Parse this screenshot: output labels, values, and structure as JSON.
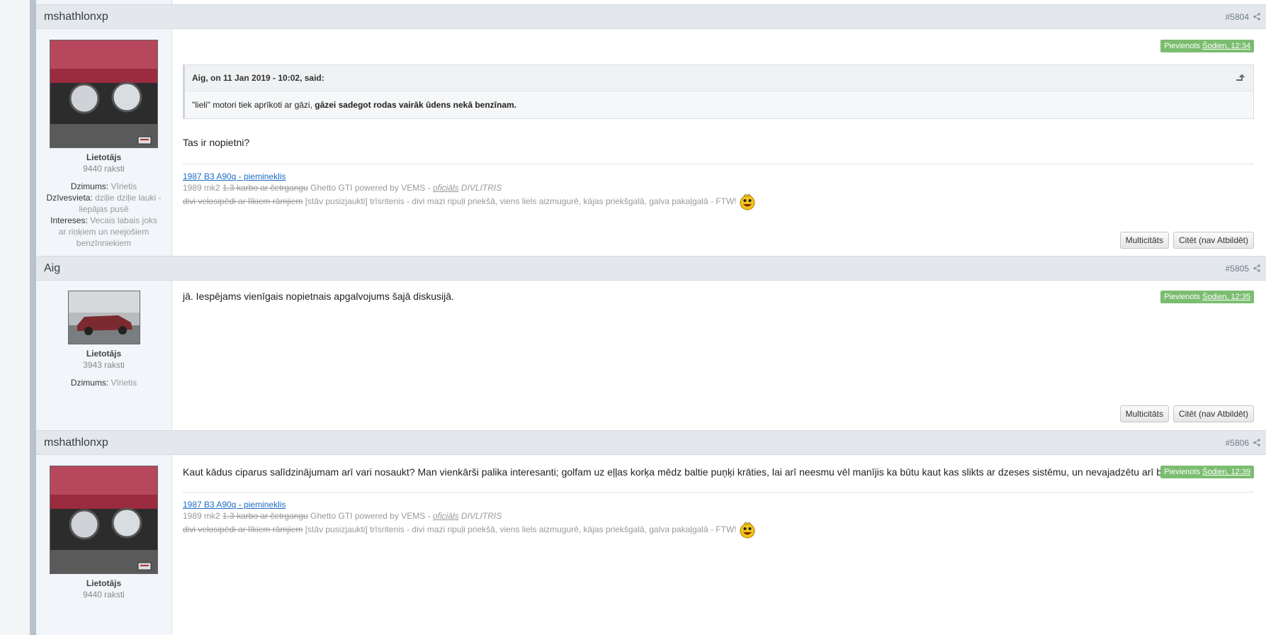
{
  "posts": [
    {
      "author": "mshathlonxp",
      "post_number": "#5804",
      "added_prefix": "Pievienots ",
      "added_time": "Šodien, 12:34",
      "role": "Lietotājs",
      "post_count": "9440 raksti",
      "fields": [
        {
          "label": "Dzimums:",
          "value": "Vīrietis"
        },
        {
          "label": "Dzīvesvieta:",
          "value": "dziļie dziļie lauki - liepājas pusē"
        },
        {
          "label": "Intereses:",
          "value": "Vecais labais joks ar riņķiem un neejošiem benzīnniekiem"
        }
      ],
      "quote": {
        "header": "Aig, on 11 Jan 2019 - 10:02, said:",
        "text_plain": "\"lieli\" motori tiek aprīkoti ar gāzi, ",
        "text_bold": "gāzei sadegot rodas vairāk ūdens nekā benzīnam."
      },
      "text": "Tas ir nopietni?",
      "signature": {
        "link": "1987 B3 A90q - piemineklis",
        "line2_a": "1989 mk2 ",
        "line2_strike": "1.3 karbo ar četrgangu",
        "line2_b": " Ghetto GTI powered by VEMS - ",
        "line2_italic_underline": "oficiāls",
        "line2_italic": " DIVLITRIS",
        "line3_strike": "divi velosipēdi ar līkiem rāmjiem",
        "line3_rest": " [stāv pusizjaukti] trīsritenis - divi mazi ripuļi priekšā, viens liels aizmugurē, kājas priekšgalā, galva pakaļgalā - FTW!"
      },
      "buttons": {
        "multiquote": "Multicitāts",
        "quote": "Citēt (nav Atbildēt)"
      }
    },
    {
      "author": "Aig",
      "post_number": "#5805",
      "added_prefix": "Pievienots ",
      "added_time": "Šodien, 12:35",
      "role": "Lietotājs",
      "post_count": "3943 raksti",
      "fields": [
        {
          "label": "Dzimums:",
          "value": "Vīrietis"
        }
      ],
      "text": "jā. Iespējams vienīgais nopietnais apgalvojums šajā diskusijā.",
      "buttons": {
        "multiquote": "Multicitāts",
        "quote": "Citēt (nav Atbildēt)"
      }
    },
    {
      "author": "mshathlonxp",
      "post_number": "#5806",
      "added_prefix": "Pievienots ",
      "added_time": "Šodien, 12:39",
      "role": "Lietotājs",
      "post_count": "9440 raksti",
      "text": "Kaut kādus ciparus salīdzinājumam arī vari nosaukt? Man vienkārši palika interesanti; golfam uz eļļas korķa mēdz baltie puņķi krāties, lai arī neesmu vēl manījis ka būtu kaut kas slikts ar dzeses sistēmu, un nevajadzētu arī būt...",
      "signature": {
        "link": "1987 B3 A90q - piemineklis",
        "line2_a": "1989 mk2 ",
        "line2_strike": "1.3 karbo ar četrgangu",
        "line2_b": " Ghetto GTI powered by VEMS - ",
        "line2_italic_underline": "oficiāls",
        "line2_italic": " DIVLITRIS",
        "line3_strike": "divi velosipēdi ar līkiem rāmjiem",
        "line3_rest": " [stāv pusizjaukti] trīsritenis - divi mazi ripuļi priekšā, viens liels aizmugurē, kājas priekšgalā, galva pakaļgalā - FTW!"
      }
    }
  ],
  "colors": {
    "badge": "#7bbd70",
    "header_bg": "#e4e8ec",
    "sidebar_bg": "#f2f5f9",
    "link": "#1e6bc7"
  }
}
